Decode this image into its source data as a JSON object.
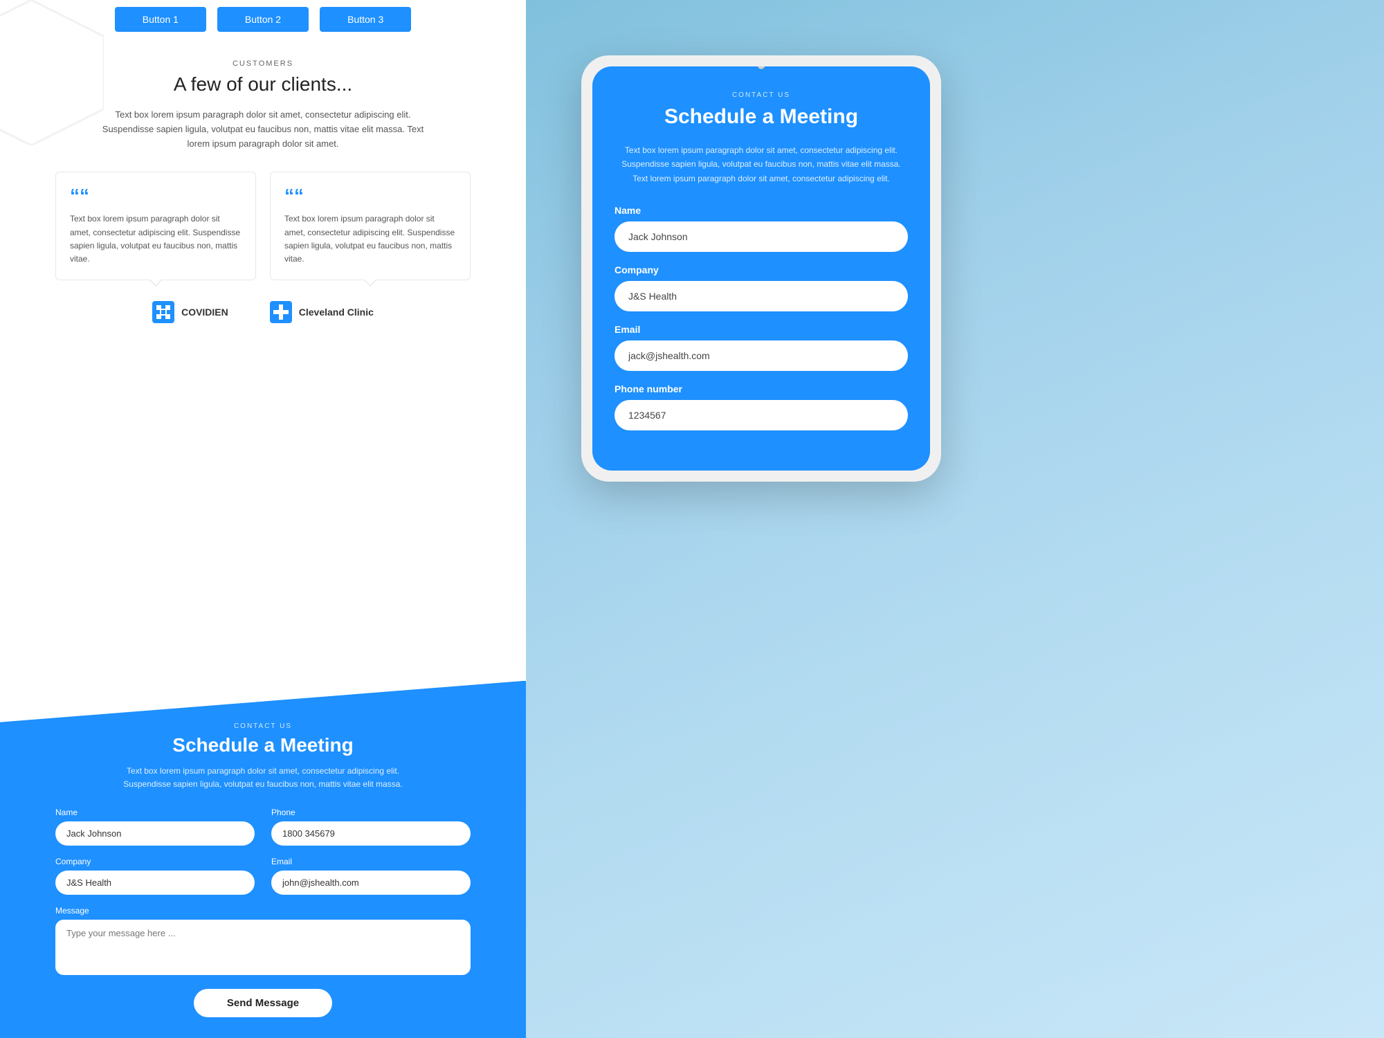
{
  "left": {
    "top_buttons": [
      "Button 1",
      "Button 2",
      "Button 3"
    ],
    "customers": {
      "label": "CUSTOMERS",
      "title": "A few of our clients...",
      "description": "Text box lorem ipsum paragraph dolor sit amet, consectetur adipiscing elit. Suspendisse sapien ligula, volutpat eu faucibus non, mattis vitae elit massa. Text lorem ipsum paragraph dolor sit amet."
    },
    "testimonials": [
      {
        "quote": "““",
        "text": "Text box lorem ipsum paragraph dolor sit amet, consectetur adipiscing elit. Suspendisse sapien ligula, volutpat eu faucibus non, mattis vitae."
      },
      {
        "quote": "““",
        "text": "Text box lorem ipsum paragraph dolor sit amet, consectetur adipiscing elit. Suspendisse sapien ligula, volutpat eu faucibus non, mattis vitae."
      }
    ],
    "logos": [
      {
        "name": "COVIDIEN"
      },
      {
        "name": "Cleveland Clinic"
      }
    ],
    "contact": {
      "label": "CONTACT US",
      "title": "Schedule a Meeting",
      "description": "Text box lorem ipsum paragraph dolor sit amet, consectetur adipiscing elit. Suspendisse sapien ligula, volutpat eu faucibus non, mattis vitae elit massa.",
      "fields": {
        "name_label": "Name",
        "name_value": "Jack Johnson",
        "phone_label": "Phone",
        "phone_value": "1800 345679",
        "company_label": "Company",
        "company_value": "J&S Health",
        "email_label": "Email",
        "email_value": "john@jshealth.com",
        "message_label": "Message",
        "message_placeholder": "Type your message here ..."
      },
      "send_button": "Send Message"
    }
  },
  "right": {
    "phone": {
      "contact_label": "CONTACT US",
      "title": "Schedule a Meeting",
      "description": "Text box lorem ipsum paragraph dolor sit amet, consectetur adipiscing elit. Suspendisse sapien ligula, volutpat eu faucibus non, mattis vitae elit massa. Text lorem ipsum paragraph dolor sit amet, consectetur adipiscing elit.",
      "fields": {
        "name_label": "Name",
        "name_value": "Jack Johnson",
        "company_label": "Company",
        "company_value": "J&S Health",
        "email_label": "Email",
        "email_value": "jack@jshealth.com",
        "phone_label": "Phone number",
        "phone_value": "1234567"
      }
    }
  }
}
